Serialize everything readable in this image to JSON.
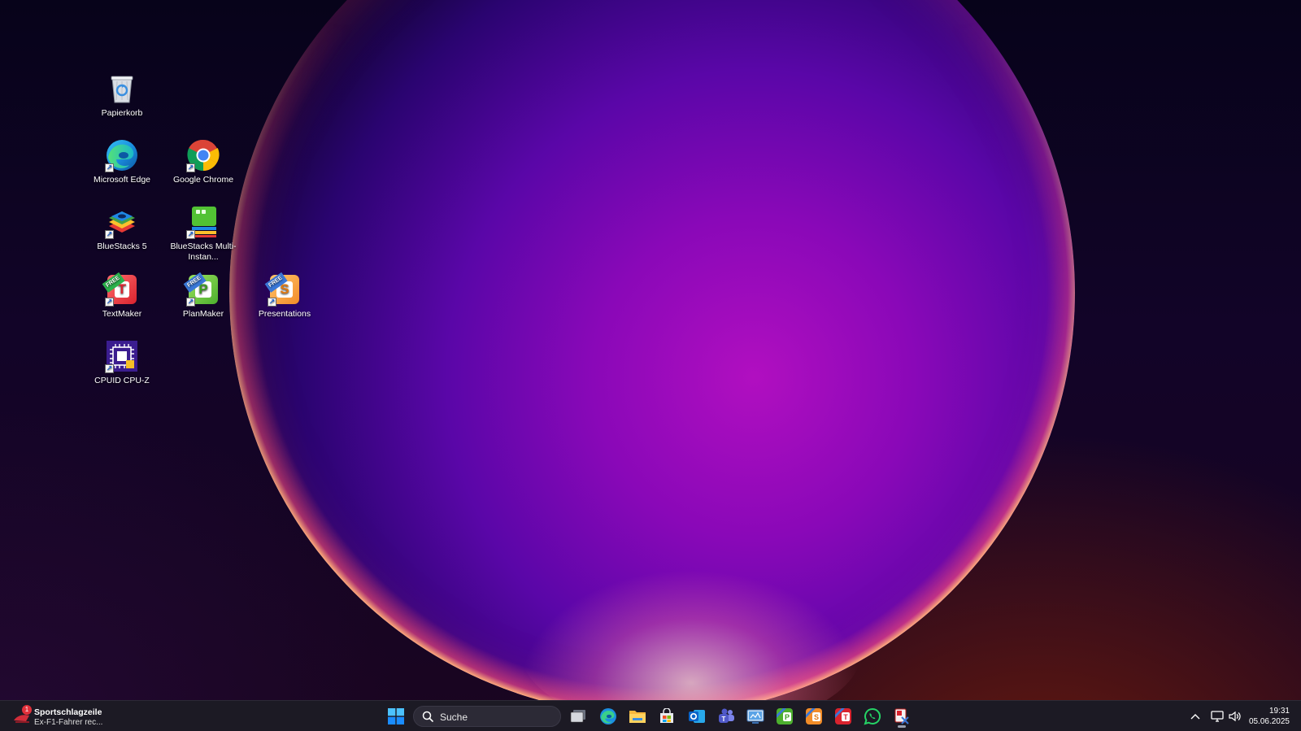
{
  "desktop_icons": [
    {
      "id": "recycle-bin",
      "label": "Papierkorb"
    },
    {
      "id": "edge",
      "label": "Microsoft Edge"
    },
    {
      "id": "chrome",
      "label": "Google Chrome"
    },
    {
      "id": "bluestacks5",
      "label": "BlueStacks 5"
    },
    {
      "id": "bluestacks-multi",
      "label": "BlueStacks Multi-Instan..."
    },
    {
      "id": "textmaker",
      "label": "TextMaker",
      "badge": "FREE",
      "letter": "T"
    },
    {
      "id": "planmaker",
      "label": "PlanMaker",
      "badge": "FREE",
      "letter": "P"
    },
    {
      "id": "presentations",
      "label": "Presentations",
      "badge": "FREE",
      "letter": "S"
    },
    {
      "id": "cpuz",
      "label": "CPUID CPU-Z"
    }
  ],
  "taskbar": {
    "news": {
      "badge_count": "1",
      "title": "Sportschlagzeile",
      "subtitle": "Ex-F1-Fahrer rec..."
    },
    "search": {
      "placeholder": "Suche"
    },
    "pinned_apps": [
      "start-icon",
      "task-view-icon",
      "edge-icon",
      "file-explorer-icon",
      "microsoft-store-icon",
      "outlook-icon",
      "teams-icon",
      "control-panel-icon",
      "planmaker-icon",
      "presentations-icon",
      "textmaker-icon",
      "whatsapp-icon",
      "snipping-tool-icon"
    ],
    "tray": {
      "time": "19:31",
      "date": "05.06.2025"
    }
  },
  "colors": {
    "taskbar_bg": "#1c1a24",
    "accent": "#1a8cff",
    "textmaker": "#d9232e",
    "planmaker": "#4caf2e",
    "presentations": "#f28c28",
    "whatsapp": "#25d366"
  }
}
